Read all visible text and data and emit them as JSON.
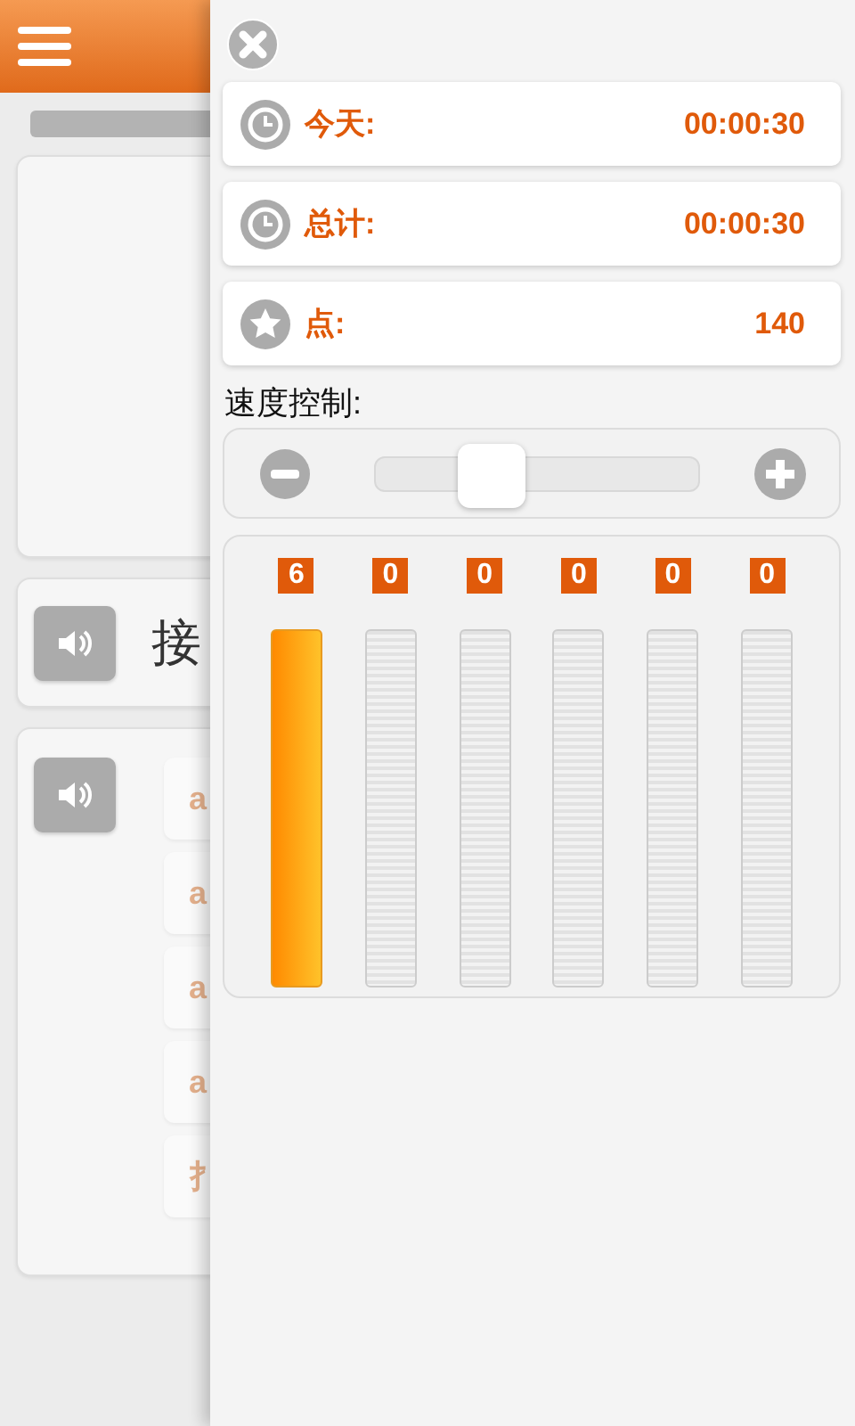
{
  "background": {
    "word": "接",
    "options": [
      {
        "text": "a"
      },
      {
        "text": "a"
      },
      {
        "text": "a"
      },
      {
        "text": "a"
      },
      {
        "text": "扌"
      }
    ]
  },
  "panel": {
    "stats": [
      {
        "kind": "clock",
        "label": "今天:",
        "value": "00:00:30"
      },
      {
        "kind": "clock",
        "label": "总计:",
        "value": "00:00:30"
      },
      {
        "kind": "star",
        "label": "点:",
        "value": "140"
      }
    ],
    "speed_label": "速度控制:",
    "speed": {
      "level": 0.36
    },
    "bars": [
      {
        "count": "6",
        "filled": true
      },
      {
        "count": "0",
        "filled": false
      },
      {
        "count": "0",
        "filled": false
      },
      {
        "count": "0",
        "filled": false
      },
      {
        "count": "0",
        "filled": false
      },
      {
        "count": "0",
        "filled": false
      }
    ]
  }
}
